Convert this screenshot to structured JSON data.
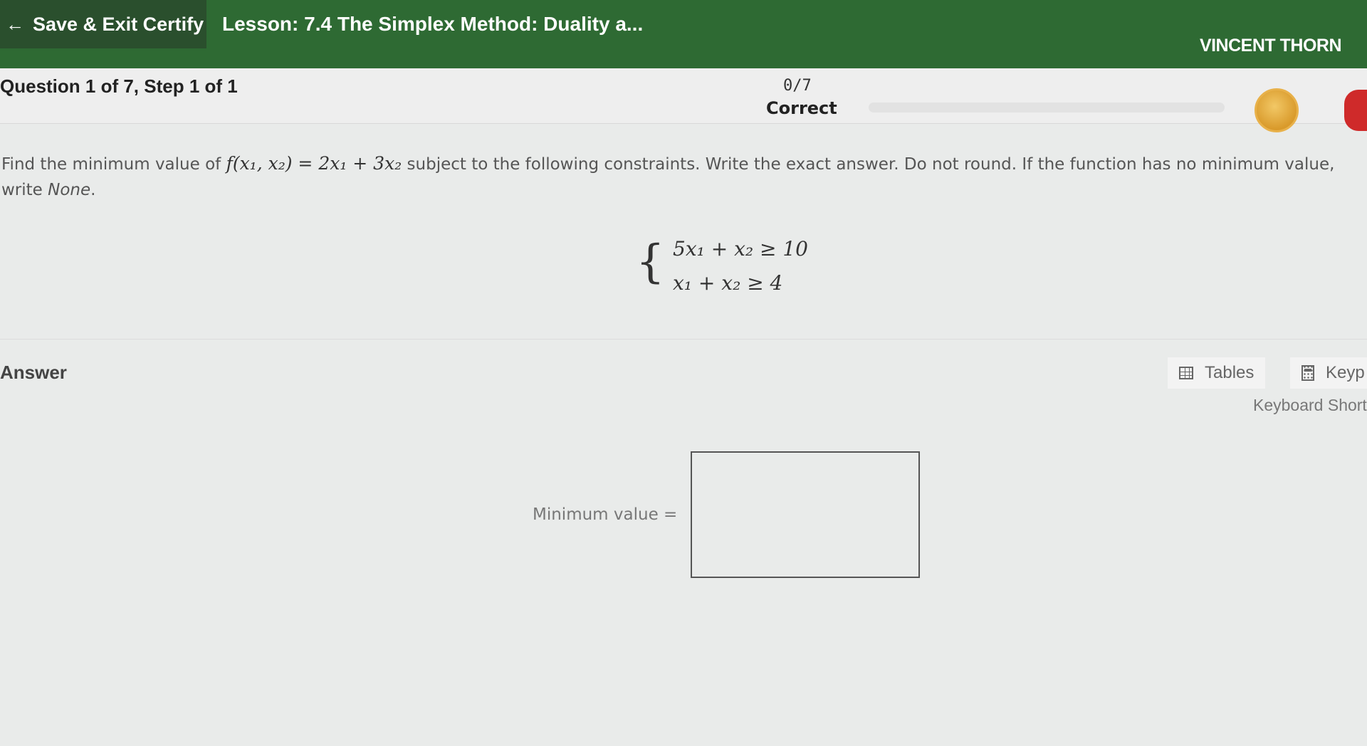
{
  "header": {
    "save_exit_label": "Save & Exit Certify",
    "lesson_title": "Lesson: 7.4 The Simplex Method: Duality a...",
    "user_name": "VINCENT THORN"
  },
  "question_header": {
    "progress": "Question 1 of 7, Step 1 of 1",
    "score_count": "0/7",
    "score_label": "Correct"
  },
  "question": {
    "prefix": "Find the minimum value of ",
    "function": "f(x₁, x₂) = 2x₁ + 3x₂",
    "suffix": " subject to the following constraints. Write the exact answer. Do not round. If the function has no minimum value, write ",
    "none_word": "None",
    "period": ".",
    "constraints": [
      "5x₁ + x₂  ≥ 10",
      "x₁ + x₂  ≥ 4"
    ]
  },
  "answer": {
    "label": "Answer",
    "tables_label": "Tables",
    "keypad_label": "Keyp",
    "shortcuts_label": "Keyboard Short",
    "min_value_label": "Minimum value =",
    "min_value_input": ""
  },
  "colors": {
    "topbar": "#2e6a33",
    "save_exit_bg": "#2a4f2d",
    "background": "#e9ebea",
    "coin": "#d99a2b",
    "flag": "#cf2a2a"
  },
  "icons": [
    "arrow-left-icon",
    "coin-icon",
    "flag-icon",
    "table-grid-icon",
    "keypad-icon"
  ]
}
